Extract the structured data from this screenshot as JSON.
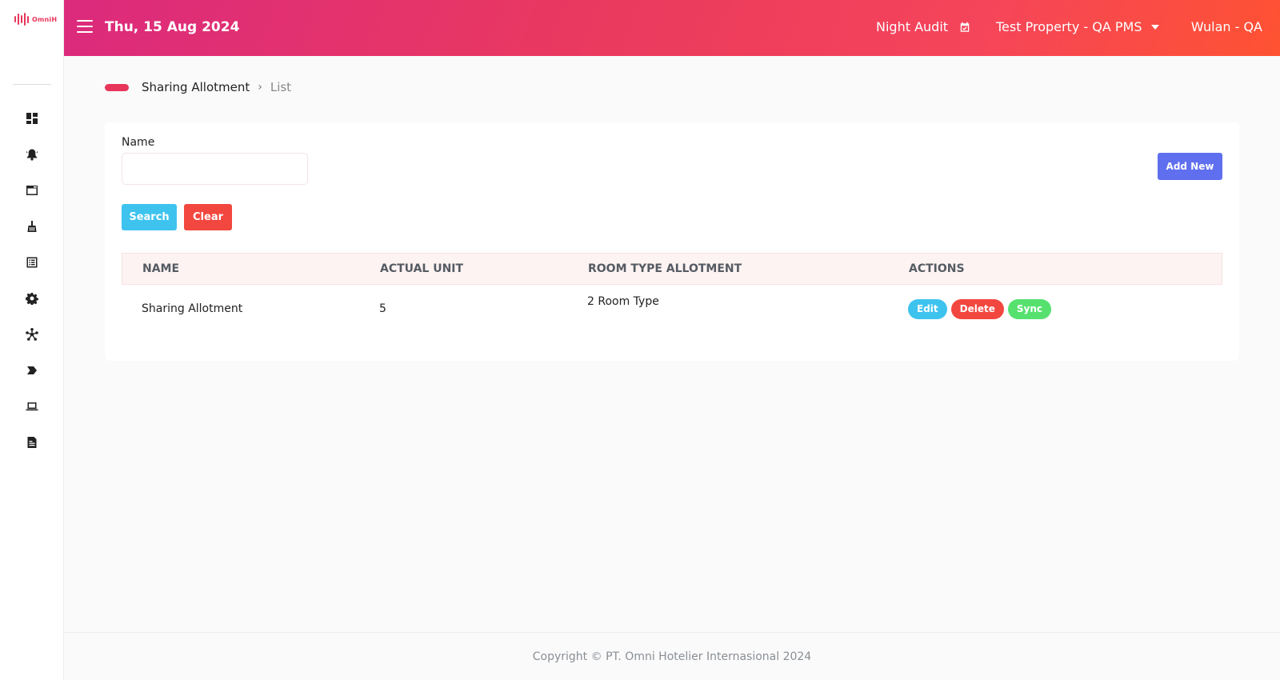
{
  "brand": {
    "logo_text": "OmniH",
    "accent": "#e8355a"
  },
  "header": {
    "date": "Thu, 15 Aug 2024",
    "night_audit": "Night Audit",
    "property": "Test Property - QA PMS",
    "user": "Wulan - QA",
    "gradient": [
      "#dc2a7d",
      "#ff5232"
    ]
  },
  "sidebar": {
    "items": [
      {
        "icon": "dashboard-icon"
      },
      {
        "icon": "bell-icon"
      },
      {
        "icon": "window-icon"
      },
      {
        "icon": "broom-icon"
      },
      {
        "icon": "list-icon"
      },
      {
        "icon": "gear-icon"
      },
      {
        "icon": "network-icon"
      },
      {
        "icon": "tag-icon"
      },
      {
        "icon": "laptop-icon"
      },
      {
        "icon": "document-icon"
      }
    ]
  },
  "breadcrumb": {
    "section": "Sharing Allotment",
    "separator": "›",
    "current": "List"
  },
  "filter": {
    "name_label": "Name",
    "name_value": "",
    "search_label": "Search",
    "clear_label": "Clear",
    "add_label": "Add New"
  },
  "table": {
    "headers": {
      "name": "NAME",
      "actual_unit": "ACTUAL UNIT",
      "room_type_allotment": "ROOM TYPE ALLOTMENT",
      "actions": "ACTIONS"
    },
    "rows": [
      {
        "name": "Sharing Allotment",
        "actual_unit": "5",
        "room_type_allotment": "2 Room Type",
        "edit": "Edit",
        "delete": "Delete",
        "sync": "Sync"
      }
    ]
  },
  "footer": {
    "copyright": "Copyright © PT. Omni Hotelier Internasional 2024"
  }
}
